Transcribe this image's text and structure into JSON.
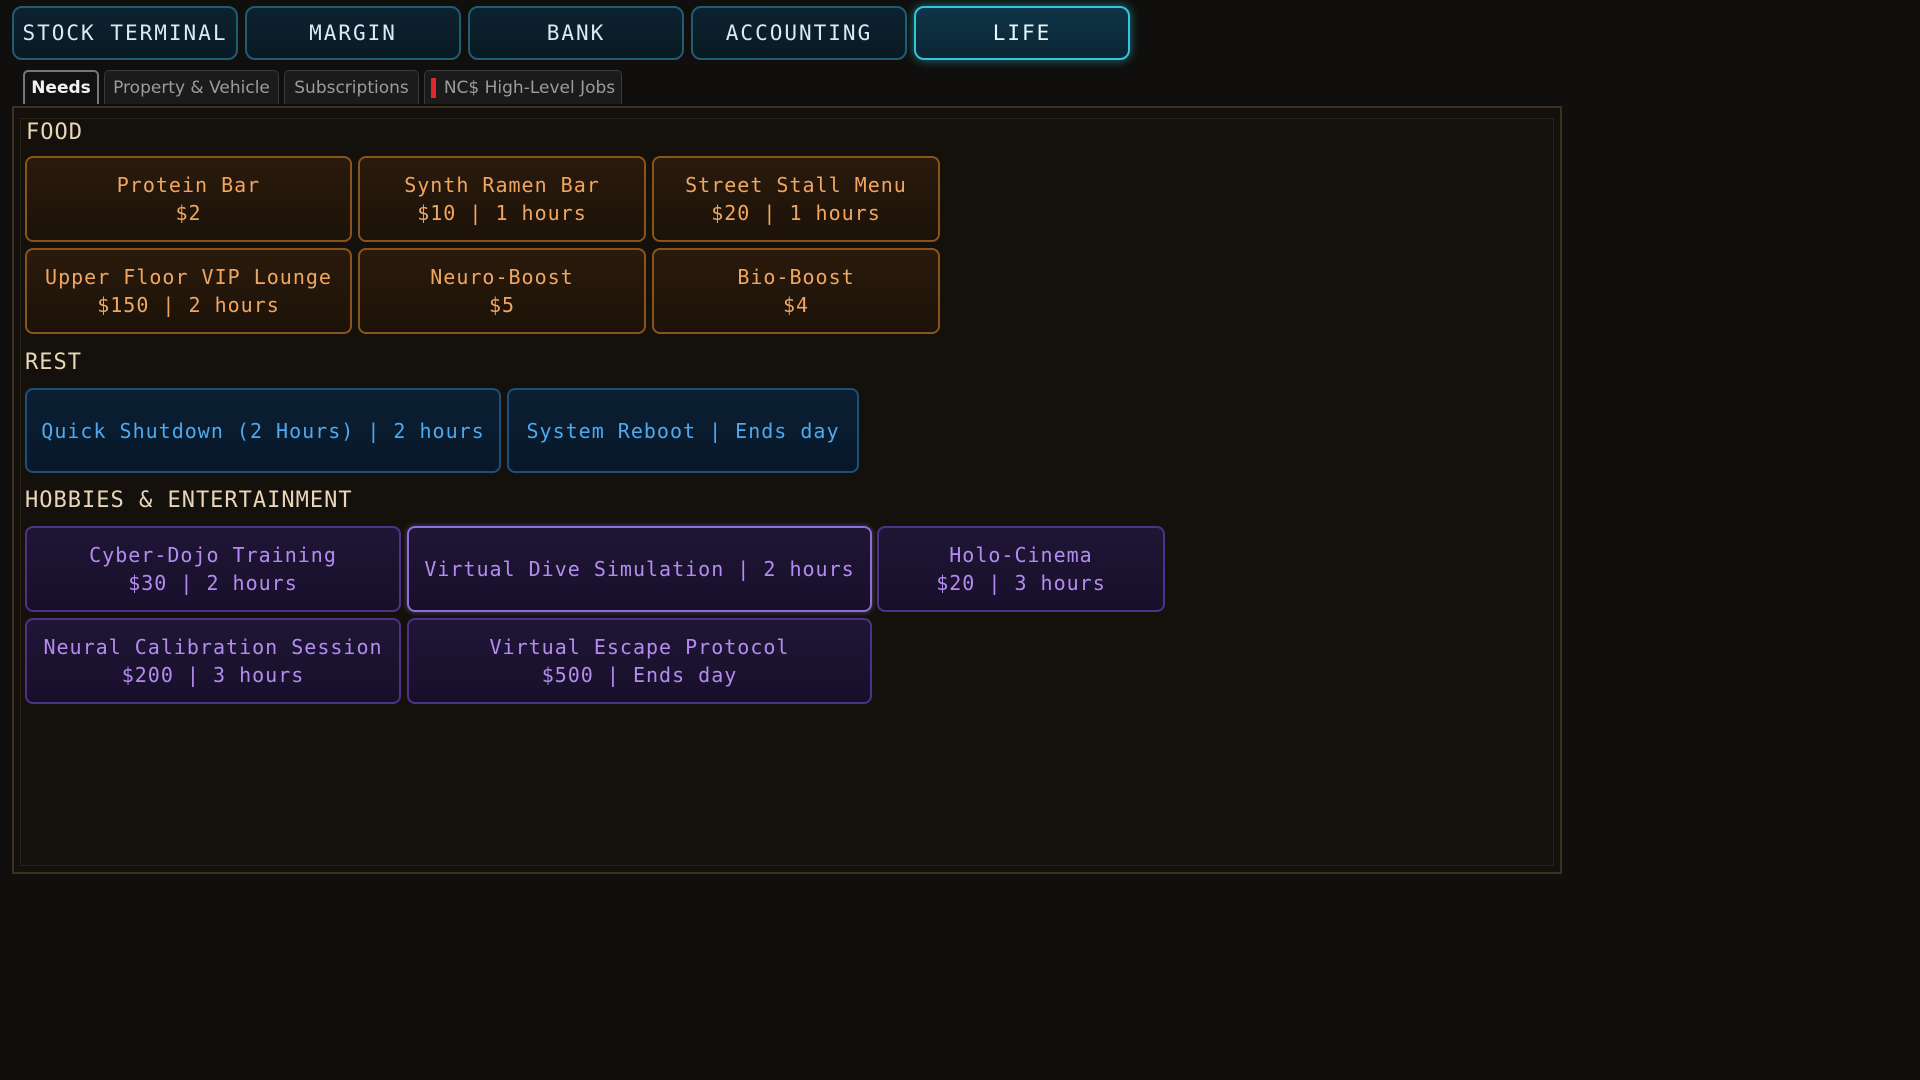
{
  "top_tabs": [
    "STOCK TERMINAL",
    "MARGIN",
    "BANK",
    "ACCOUNTING",
    "LIFE"
  ],
  "active_top_tab": "LIFE",
  "sub_tabs": [
    "Needs",
    "Property & Vehicle",
    "Subscriptions",
    "NC$ High-Level Jobs"
  ],
  "active_sub_tab": "Needs",
  "sections": {
    "food": {
      "title": "FOOD",
      "items": [
        {
          "name": "Protein Bar",
          "detail": "$2"
        },
        {
          "name": "Synth Ramen Bar",
          "detail": "$10 | 1 hours"
        },
        {
          "name": "Street Stall Menu",
          "detail": "$20 | 1 hours"
        },
        {
          "name": "Upper Floor VIP Lounge",
          "detail": "$150 | 2 hours"
        },
        {
          "name": "Neuro-Boost",
          "detail": "$5"
        },
        {
          "name": "Bio-Boost",
          "detail": "$4"
        }
      ]
    },
    "rest": {
      "title": "REST",
      "items": [
        {
          "name": "Quick Shutdown (2 Hours) | 2 hours"
        },
        {
          "name": "System Reboot | Ends day"
        }
      ]
    },
    "hobbies": {
      "title": "HOBBIES & ENTERTAINMENT",
      "items": [
        {
          "name": "Cyber-Dojo Training",
          "detail": "$30 | 2 hours"
        },
        {
          "name": "Virtual Dive Simulation | 2 hours"
        },
        {
          "name": "Holo-Cinema",
          "detail": "$20 | 3 hours"
        },
        {
          "name": "Neural Calibration Session",
          "detail": "$200 | 3 hours"
        },
        {
          "name": "Virtual Escape Protocol",
          "detail": "$500 | Ends day"
        }
      ]
    }
  },
  "colors": {
    "food_accent": "#f0a660",
    "rest_accent": "#4ea9ee",
    "hobby_accent": "#b48cf0",
    "active_tab_glow": "#2fc6e0",
    "jobs_marker": "#e0282c"
  }
}
